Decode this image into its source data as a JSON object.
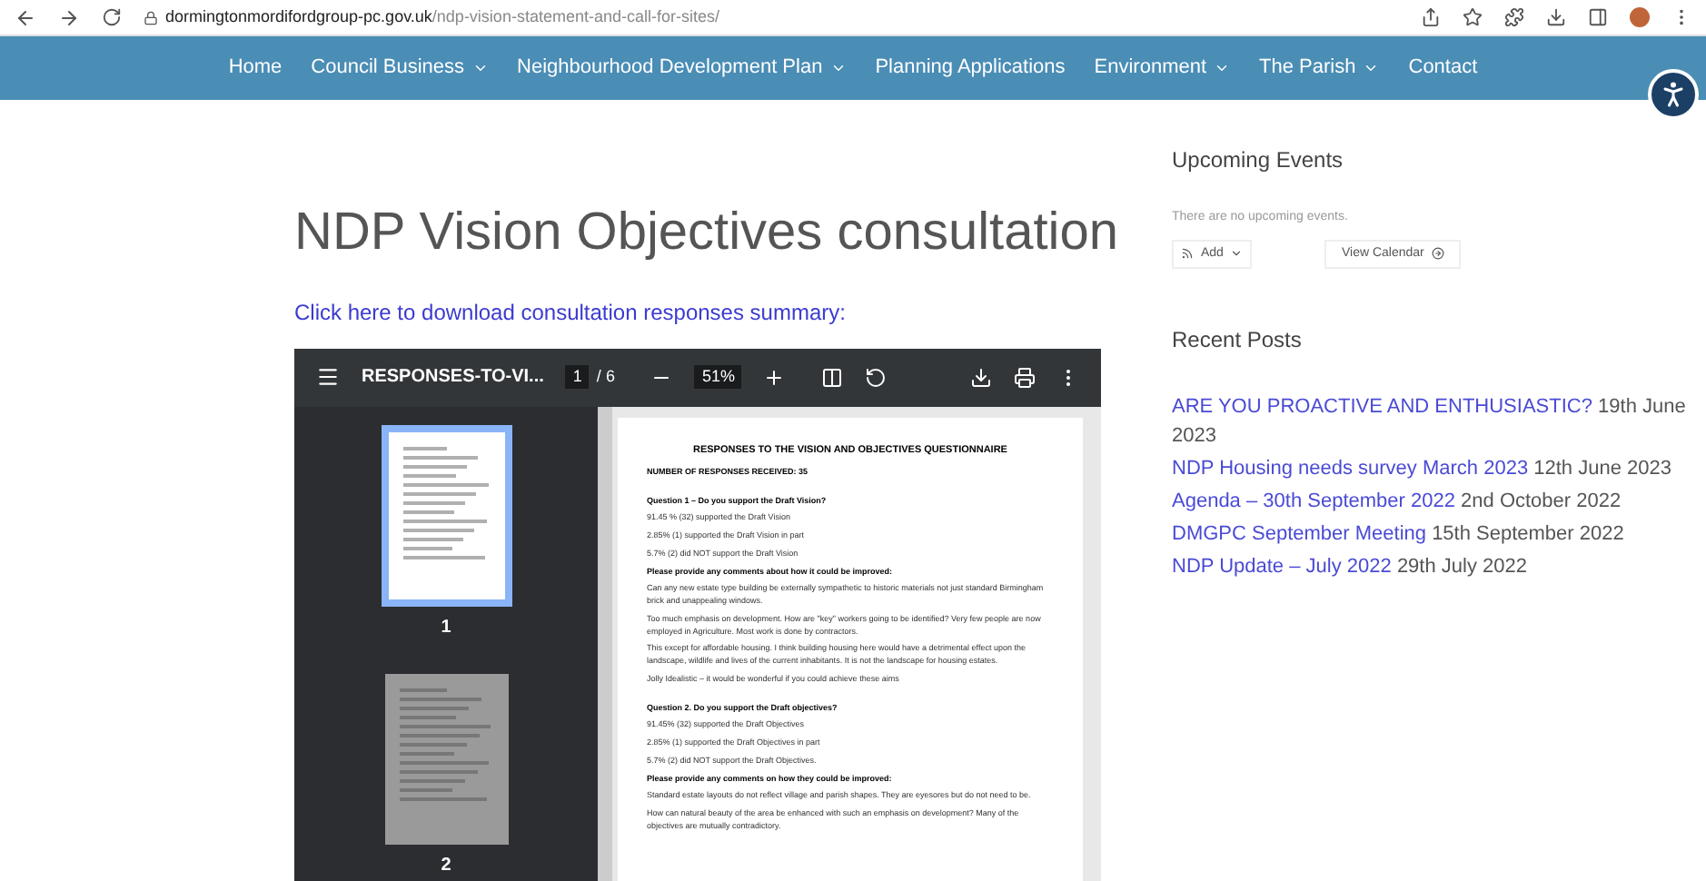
{
  "browser": {
    "url_host": "dormingtonmordifordgroup-pc.gov.uk",
    "url_path": "/ndp-vision-statement-and-call-for-sites/"
  },
  "nav": [
    {
      "label": "Home",
      "dropdown": false
    },
    {
      "label": "Council Business",
      "dropdown": true
    },
    {
      "label": "Neighbourhood Development Plan",
      "dropdown": true
    },
    {
      "label": "Planning Applications",
      "dropdown": false
    },
    {
      "label": "Environment",
      "dropdown": true
    },
    {
      "label": "The Parish",
      "dropdown": true
    },
    {
      "label": "Contact",
      "dropdown": false
    }
  ],
  "page": {
    "title": "NDP Vision Objectives consultation",
    "download_link": "Click here to download consultation responses summary:"
  },
  "pdf_viewer": {
    "file_name": "RESPONSES-TO-VI...",
    "page_current": "1",
    "page_separator": "/",
    "page_total": "6",
    "zoom": "51%",
    "thumbnails": [
      {
        "label": "1",
        "selected": true
      },
      {
        "label": "2",
        "selected": false
      }
    ],
    "document": [
      {
        "kind": "title",
        "text": "RESPONSES TO THE VISION AND OBJECTIVES QUESTIONNAIRE"
      },
      {
        "kind": "heading",
        "text": "NUMBER OF RESPONSES RECEIVED:  35"
      },
      {
        "kind": "question",
        "text": "Question 1 – Do you support the Draft Vision?"
      },
      {
        "kind": "line",
        "text": "91.45 % (32) supported the Draft Vision"
      },
      {
        "kind": "line",
        "text": "2.85% (1) supported the Draft Vision in part"
      },
      {
        "kind": "line",
        "text": "5.7% (2) did NOT support the Draft Vision"
      },
      {
        "kind": "heading",
        "text": "Please provide any comments about how it could be improved:"
      },
      {
        "kind": "line",
        "text": "Can any new estate type building be externally sympathetic to historic materials not just standard Birmingham brick and unappealing windows."
      },
      {
        "kind": "line",
        "text": "Too much emphasis on development.  How are \"key\" workers going to be identified?  Very few people are now employed in Agriculture.  Most work is done by contractors."
      },
      {
        "kind": "line",
        "text": "This except for affordable housing. I think building housing here would have a detrimental effect upon the landscape, wildlife and lives of the current inhabitants. It is not the landscape for housing estates."
      },
      {
        "kind": "line",
        "text": "Jolly Idealistic – it would be wonderful if you could achieve these aims"
      },
      {
        "kind": "question",
        "text": "Question 2.  Do you support the Draft objectives?"
      },
      {
        "kind": "line",
        "text": "91.45% (32) supported the Draft Objectives"
      },
      {
        "kind": "line",
        "text": "2.85% (1) supported the Draft Objectives in part"
      },
      {
        "kind": "line",
        "text": "5.7% (2) did NOT support the Draft Objectives."
      },
      {
        "kind": "heading",
        "text": "Please provide any comments on how they could be improved:"
      },
      {
        "kind": "line",
        "text": "Standard estate layouts do not reflect village and parish shapes.  They are eyesores but do not need to be."
      },
      {
        "kind": "line",
        "text": "How can natural beauty of the area be enhanced with such an emphasis on development? Many of the objectives are mutually contradictory."
      }
    ]
  },
  "sidebar": {
    "events_title": "Upcoming Events",
    "events_empty": "There are no upcoming events.",
    "add_button": "Add",
    "calendar_button": "View Calendar",
    "posts_title": "Recent Posts",
    "posts": [
      {
        "title": "ARE YOU PROACTIVE AND ENTHUSIASTIC?",
        "date": "19th June 2023"
      },
      {
        "title": "NDP Housing needs survey March 2023",
        "date": "12th June 2023"
      },
      {
        "title": "Agenda – 30th September 2022",
        "date": "2nd October 2022"
      },
      {
        "title": "DMGPC September Meeting",
        "date": "15th September 2022"
      },
      {
        "title": "NDP Update – July 2022",
        "date": "29th July 2022"
      }
    ]
  }
}
